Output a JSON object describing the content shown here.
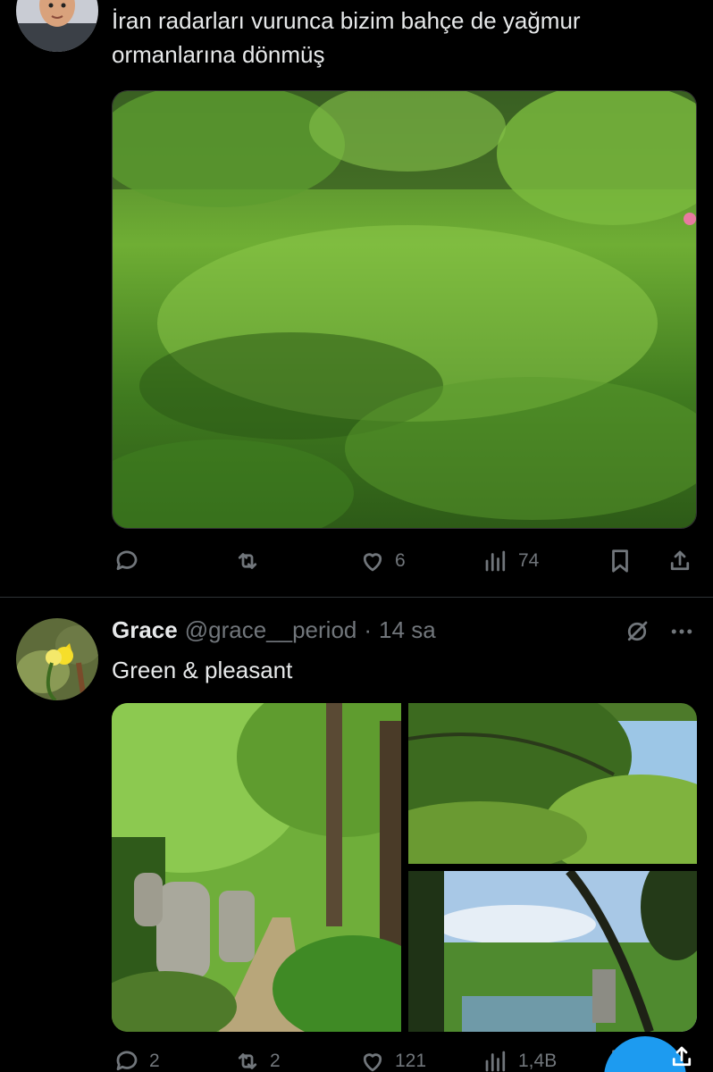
{
  "tweet1": {
    "text": "İran radarları vurunca bizim bahçe de yağmur ormanlarına dönmüş",
    "actions": {
      "reply": "",
      "retweet": "",
      "like": "6",
      "views": "74"
    },
    "avatar_icon": "avatar-photo-boy"
  },
  "tweet2": {
    "name": "Grace",
    "handle": "@grace__period",
    "sep": "·",
    "time": "14 sa",
    "text": "Green & pleasant",
    "actions": {
      "reply": "2",
      "retweet": "2",
      "like": "121",
      "views": "1,4B"
    },
    "avatar_icon": "avatar-photo-daffodil"
  },
  "colors": {
    "background": "#000000",
    "text": "#e7e9ea",
    "muted": "#71767b",
    "accent": "#1d9bf0",
    "divider": "#2f3336"
  },
  "icons": [
    "reply-icon",
    "retweet-icon",
    "like-icon",
    "views-icon",
    "bookmark-icon",
    "share-icon",
    "grok-icon",
    "more-icon"
  ]
}
